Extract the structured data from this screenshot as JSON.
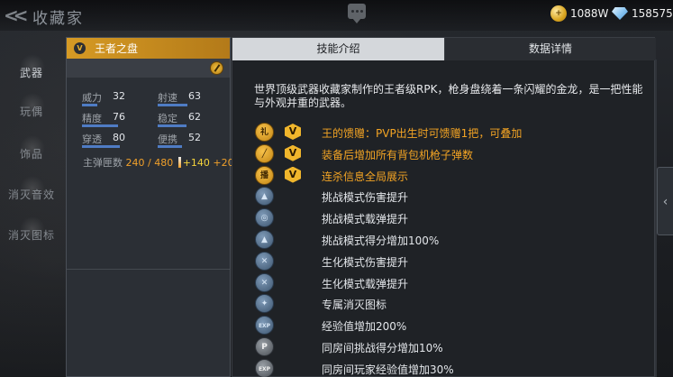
{
  "header": {
    "back_icon": "chevron-double-left-icon",
    "title": "收藏家",
    "chat_icon": "chat-bubble-icon",
    "gold_amount": "1088W",
    "diamond_amount": "158575"
  },
  "sidebar": {
    "items": [
      {
        "label": "武器"
      },
      {
        "label": "玩偶"
      },
      {
        "label": "饰品"
      },
      {
        "label": "消灭音效"
      },
      {
        "label": "消灭图标"
      }
    ]
  },
  "weapon": {
    "name": "王者之盘",
    "stats": [
      {
        "label": "威力",
        "value": "32",
        "level": 0.32
      },
      {
        "label": "射速",
        "value": "63",
        "level": 0.63
      },
      {
        "label": "精度",
        "value": "76",
        "level": 0.76
      },
      {
        "label": "稳定",
        "value": "62",
        "level": 0.62
      },
      {
        "label": "穿透",
        "value": "80",
        "level": 0.8
      },
      {
        "label": "便携",
        "value": "52",
        "level": 0.52
      }
    ],
    "ammo_label": "主弹匣数",
    "ammo_current": "240 / 480",
    "ammo_bonus_1": "+140",
    "ammo_bonus_2": "+20"
  },
  "tabs": [
    {
      "label": "技能介绍",
      "active": true
    },
    {
      "label": "数据详情",
      "active": false
    }
  ],
  "description": "世界顶级武器收藏家制作的王者级RPK，枪身盘绕着一条闪耀的金龙，是一把性能与外观并重的武器。",
  "skills": [
    {
      "text": "王的馈赠：PVP出生时可馈赠1把，可叠加",
      "icon": "gift-icon",
      "style": "gold",
      "vip": true
    },
    {
      "text": "装备后增加所有背包机枪子弹数",
      "icon": "bullet-icon",
      "style": "gold",
      "vip": true
    },
    {
      "text": "连杀信息全局展示",
      "icon": "broadcast-icon",
      "style": "gold",
      "vip": true
    },
    {
      "text": "挑战模式伤害提升",
      "icon": "challenge-damage-icon",
      "style": "blue",
      "vip": false
    },
    {
      "text": "挑战模式载弹提升",
      "icon": "challenge-ammo-icon",
      "style": "blue",
      "vip": false
    },
    {
      "text": "挑战模式得分增加100%",
      "icon": "challenge-score-icon",
      "style": "blue",
      "vip": false
    },
    {
      "text": "生化模式伤害提升",
      "icon": "zombie-damage-icon",
      "style": "blue",
      "vip": false
    },
    {
      "text": "生化模式载弹提升",
      "icon": "zombie-ammo-icon",
      "style": "blue",
      "vip": false
    },
    {
      "text": "专属消灭图标",
      "icon": "kill-mark-icon",
      "style": "blue",
      "vip": false
    },
    {
      "text": "经验值增加200%",
      "icon": "exp-icon",
      "style": "blue",
      "vip": false
    },
    {
      "text": "同房间挑战得分增加10%",
      "icon": "room-score-icon",
      "style": "gray",
      "vip": false
    },
    {
      "text": "同房间玩家经验值增加30%",
      "icon": "room-exp-icon",
      "style": "gray",
      "vip": false
    }
  ]
}
